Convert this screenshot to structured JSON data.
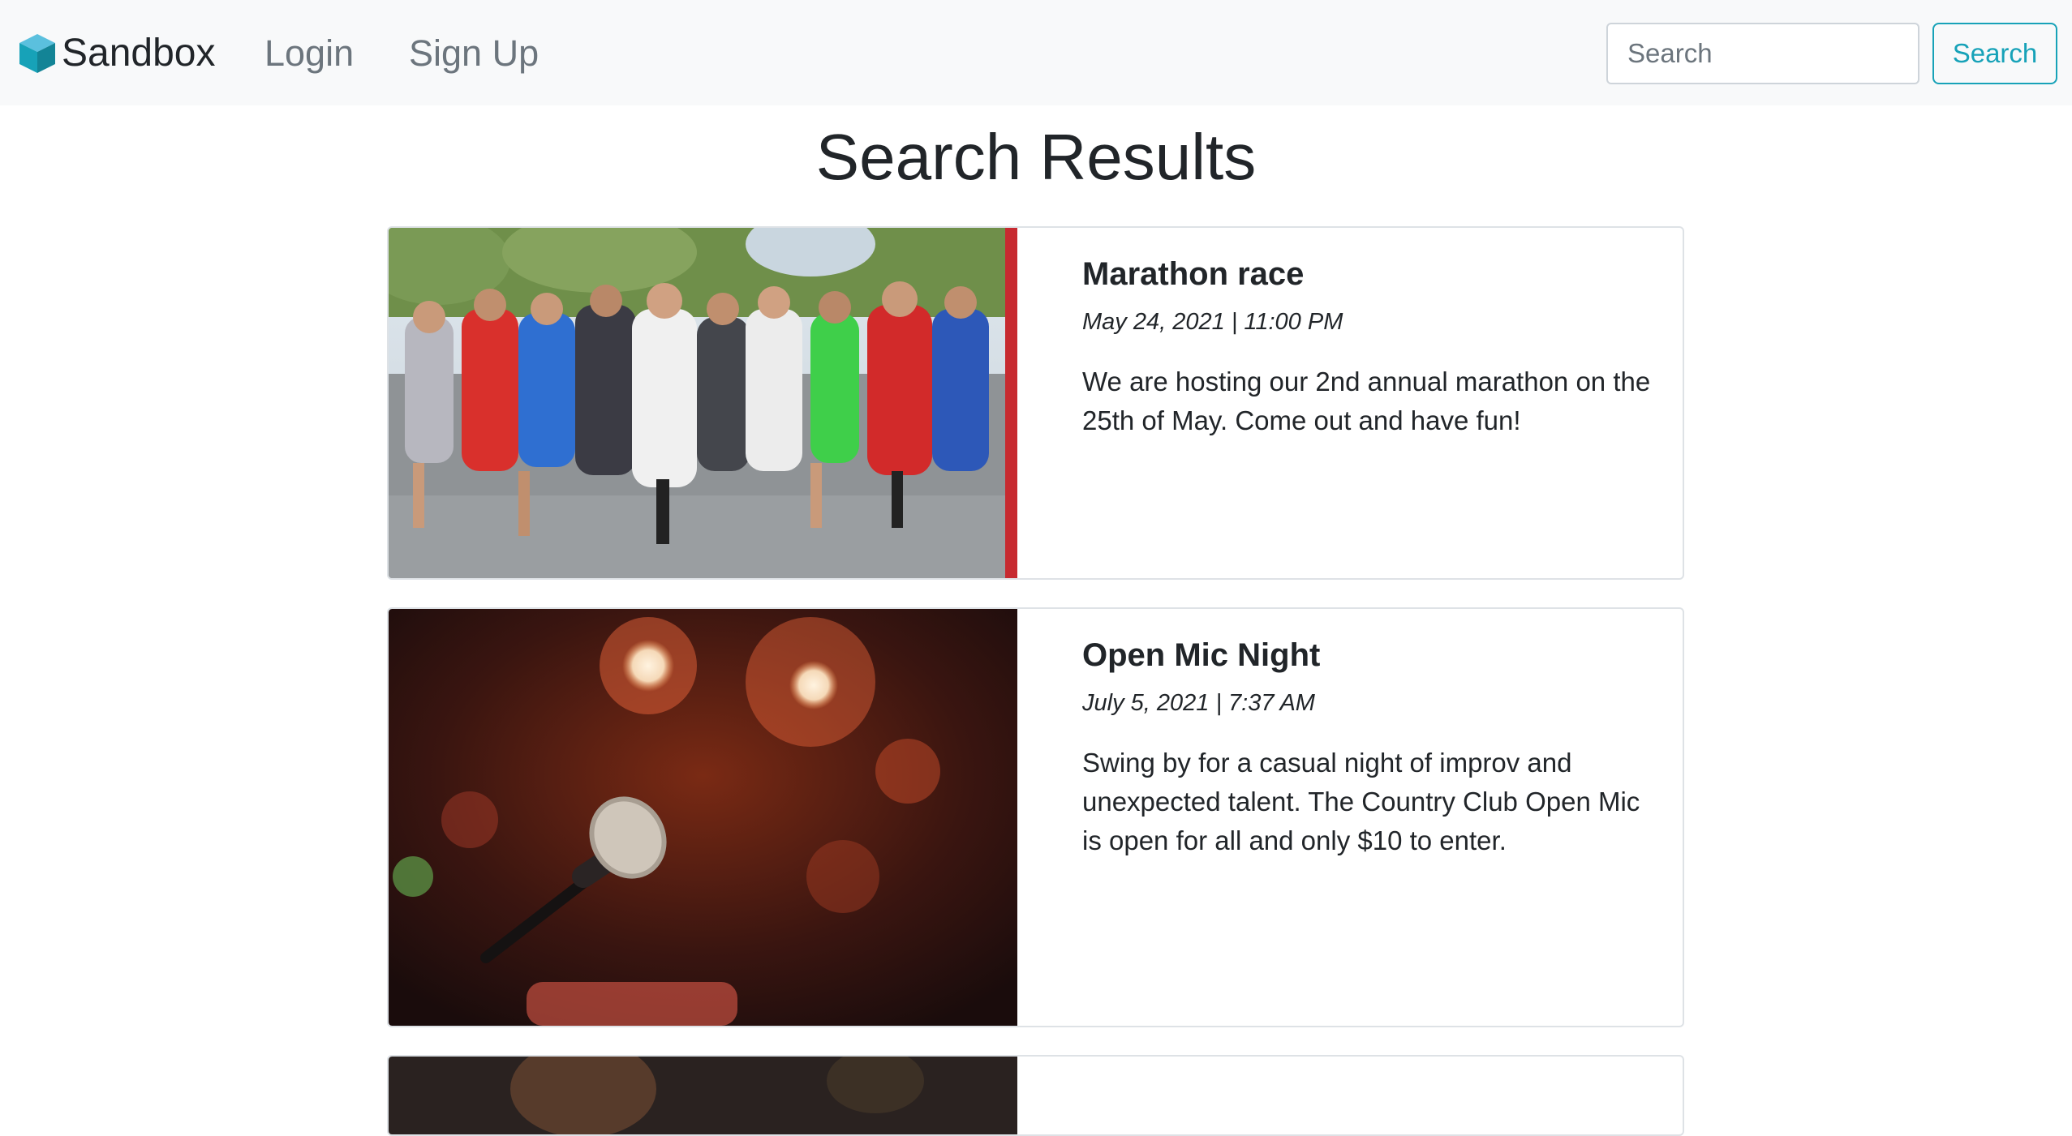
{
  "navbar": {
    "brand": "Sandbox",
    "links": [
      {
        "label": "Login"
      },
      {
        "label": "Sign Up"
      }
    ],
    "search": {
      "placeholder": "Search",
      "button_label": "Search"
    },
    "accent_color": "#17a2b8"
  },
  "page": {
    "title": "Search Results"
  },
  "results": [
    {
      "title": "Marathon race",
      "date": "May 24, 2021 | 11:00 PM",
      "description": "We are hosting our 2nd annual marathon on the 25th of May. Come out and have fun!",
      "image": "marathon-runners-photo"
    },
    {
      "title": "Open Mic Night",
      "date": "July 5, 2021 | 7:37 AM",
      "description": "Swing by for a casual night of improv and unexpected talent. The Country Club Open Mic is open for all and only $10 to enter.",
      "image": "microphone-stage-photo"
    },
    {
      "image": "performer-photo"
    }
  ]
}
